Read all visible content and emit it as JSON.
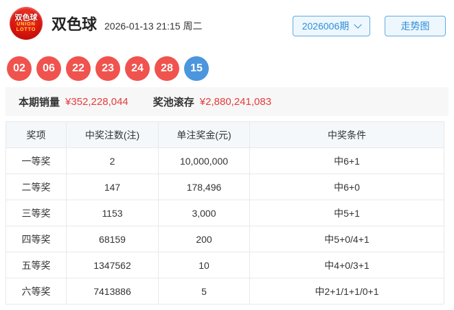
{
  "header": {
    "logo": {
      "line1": "双色球",
      "line2": "UNION",
      "line3": "LOTTO"
    },
    "title": "双色球",
    "datetime": "2026-01-13 21:15 周二",
    "issue_selector": "2026006期",
    "trend_button": "走势图"
  },
  "draw": {
    "red_balls": [
      "02",
      "06",
      "22",
      "23",
      "24",
      "28"
    ],
    "blue_ball": "15"
  },
  "sales": {
    "sales_label": "本期销量",
    "sales_value": "¥352,228,044",
    "pool_label": "奖池滚存",
    "pool_value": "¥2,880,241,083"
  },
  "table": {
    "headers": [
      "奖项",
      "中奖注数(注)",
      "单注奖金(元)",
      "中奖条件"
    ],
    "rows": [
      [
        "一等奖",
        "2",
        "10,000,000",
        "中6+1"
      ],
      [
        "二等奖",
        "147",
        "178,496",
        "中6+0"
      ],
      [
        "三等奖",
        "1153",
        "3,000",
        "中5+1"
      ],
      [
        "四等奖",
        "68159",
        "200",
        "中5+0/4+1"
      ],
      [
        "五等奖",
        "1347562",
        "10",
        "中4+0/3+1"
      ],
      [
        "六等奖",
        "7413886",
        "5",
        "中2+1/1+1/0+1"
      ]
    ]
  },
  "colors": {
    "red_ball": "#f0534e",
    "blue_ball": "#4b96dd",
    "accent_blue": "#2a8fd8",
    "value_red": "#e53b3b",
    "table_header_bg": "#f4f8fb",
    "strip_bg": "#f7f7f7"
  }
}
